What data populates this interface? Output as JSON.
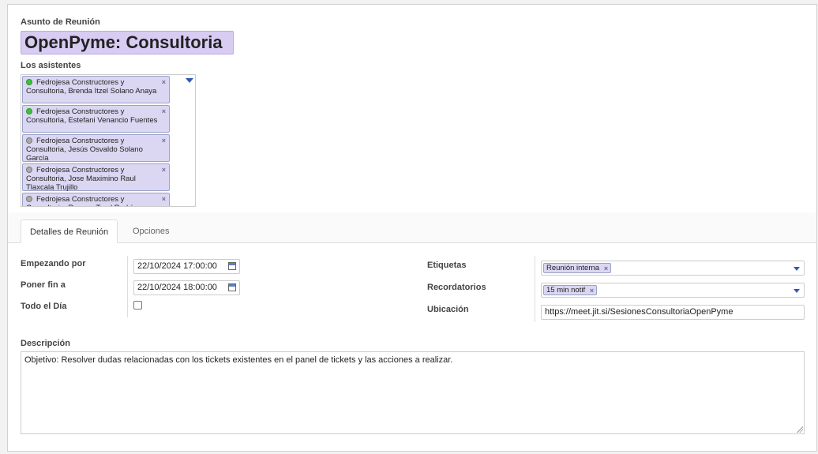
{
  "form": {
    "subject_label": "Asunto de Reunión",
    "subject_value": "OpenPyme: Consultoria",
    "attendees_label": "Los asistentes",
    "attendees": [
      {
        "text": "Fedrojesa Constructores y Consultoria, Brenda Itzel Solano Anaya",
        "status": "online"
      },
      {
        "text": "Fedrojesa Constructores y Consultoria, Estefani Venancio Fuentes",
        "status": "online"
      },
      {
        "text": "Fedrojesa Constructores y Consultoria, Jesús Osvaldo Solano García",
        "status": "offline"
      },
      {
        "text": "Fedrojesa Constructores y Consultoria, Jose Maximino Raul Tlaxcala Trujillo",
        "status": "offline"
      },
      {
        "text": "Fedrojesa Constructores y Consultoria, Roxana Toral Rodríguez",
        "status": "offline"
      }
    ],
    "remove_glyph": "×"
  },
  "tabs": [
    {
      "label": "Detalles de Reunión",
      "active": true
    },
    {
      "label": "Opciones",
      "active": false
    }
  ],
  "details": {
    "start_label": "Empezando por",
    "start_value": "22/10/2024 17:00:00",
    "end_label": "Poner fin a",
    "end_value": "22/10/2024 18:00:00",
    "allday_label": "Todo el Día",
    "allday_checked": false,
    "tags_label": "Etiquetas",
    "tags_value": "Reunión interna",
    "reminders_label": "Recordatorios",
    "reminders_value": "15 min notif",
    "location_label": "Ubicación",
    "location_value": "https://meet.jit.si/SesionesConsultoriaOpenPyme",
    "description_label": "Descripción",
    "description_value": "Objetivo: Resolver dudas relacionadas con los tickets existentes en el panel de tickets y las acciones a realizar."
  }
}
